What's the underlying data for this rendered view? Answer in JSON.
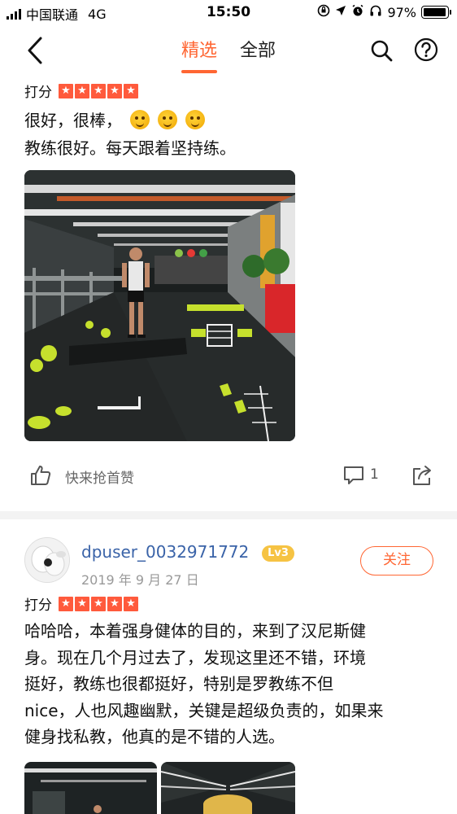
{
  "status_bar": {
    "carrier": "中国联通",
    "network": "4G",
    "time": "15:50",
    "battery": "97%",
    "battery_level": 0.97
  },
  "nav": {
    "tabs": [
      {
        "label": "精选",
        "active": true
      },
      {
        "label": "全部",
        "active": false
      }
    ],
    "icons": [
      "back-icon",
      "search-icon",
      "help-icon"
    ]
  },
  "review_1": {
    "rating_label": "打分",
    "stars": 5,
    "text_line1": "很好，很棒，",
    "text_line2": "教练很好。每天跟着坚持练。",
    "emoji": [
      "wink-emoji",
      "wink-emoji",
      "wink-emoji"
    ],
    "like_text": "快来抢首赞",
    "comment_count": "1"
  },
  "review_2": {
    "username": "dpuser_0032971772",
    "level": "Lv3",
    "date": "2019 年 9 月 27 日",
    "follow_label": "关注",
    "rating_label": "打分",
    "stars": 5,
    "text_lines": [
      "哈哈哈，本着强身健体的目的，来到了汉尼斯健",
      "身。现在几个月过去了，发现这里还不错，环境",
      "挺好，教练也很都挺好，特别是罗教练不但",
      "nice，人也风趣幽默，关键是超级负责的，如果来",
      "健身找私教，他真的是不错的人选。"
    ]
  },
  "colors": {
    "accent": "#ff6633",
    "star": "#ff5a3c",
    "username": "#3a63a8",
    "level_badge": "#f6c343"
  }
}
